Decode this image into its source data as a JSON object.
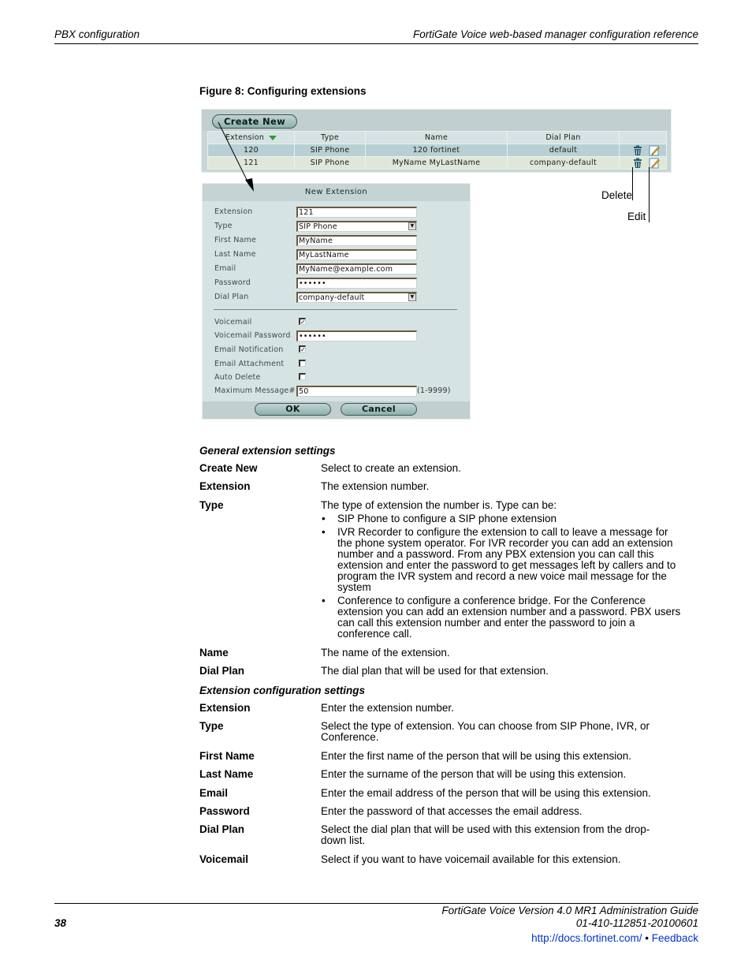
{
  "running_header": {
    "left": "PBX configuration",
    "right": "FortiGate Voice web-based manager configuration reference"
  },
  "figure": {
    "caption": "Figure 8: Configuring extensions",
    "extension_list": {
      "create_new_label": "Create New",
      "columns": [
        "Extension",
        "Type",
        "Name",
        "Dial Plan",
        ""
      ],
      "sort_column": "Extension",
      "rows": [
        {
          "extension": "120",
          "type": "SIP Phone",
          "name": "120 fortinet",
          "dial_plan": "default",
          "actions": [
            "delete-icon",
            "edit-icon"
          ]
        },
        {
          "extension": "121",
          "type": "SIP Phone",
          "name": "MyName MyLastName",
          "dial_plan": "company-default",
          "actions": [
            "delete-icon",
            "edit-icon"
          ]
        }
      ]
    },
    "callouts": {
      "delete": "Delete",
      "edit": "Edit"
    },
    "new_extension_dialog": {
      "title": "New Extension",
      "fields": {
        "extension": {
          "label": "Extension",
          "value": "121"
        },
        "type": {
          "label": "Type",
          "value": "SIP Phone"
        },
        "first_name": {
          "label": "First Name",
          "value": "MyName"
        },
        "last_name": {
          "label": "Last Name",
          "value": "MyLastName"
        },
        "email": {
          "label": "Email",
          "value": "MyName@example.com"
        },
        "password": {
          "label": "Password",
          "value": "••••••"
        },
        "dial_plan": {
          "label": "Dial Plan",
          "value": "company-default"
        },
        "voicemail": {
          "label": "Voicemail",
          "checked": true,
          "mark": "✓"
        },
        "voicemail_password": {
          "label": "Voicemail Password",
          "value": "••••••"
        },
        "email_notification": {
          "label": "Email Notification",
          "checked": true,
          "mark": "✓"
        },
        "email_attachment": {
          "label": "Email Attachment",
          "checked": false,
          "mark": ""
        },
        "auto_delete": {
          "label": "Auto Delete",
          "checked": false,
          "mark": ""
        },
        "maximum_message": {
          "label": "Maximum Message#",
          "value": "50",
          "hint": "(1-9999)"
        }
      },
      "ok_label": "OK",
      "cancel_label": "Cancel"
    }
  },
  "general_settings": {
    "heading": "General extension settings",
    "items": [
      {
        "term": "Create New",
        "definition": "Select to create an extension."
      },
      {
        "term": "Extension",
        "definition": "The extension number."
      },
      {
        "term": "Type",
        "definition": "The type of extension the number is. Type can be:",
        "bullets": [
          "SIP Phone to configure a SIP phone extension",
          "IVR Recorder to configure the extension to call to leave a message for the phone system operator. For IVR recorder you can add an extension number and a password. From any PBX extension you can call this extension and enter the password to get messages left by callers and to program the IVR system and record a new voice mail message for the system",
          "Conference to configure a conference bridge. For the Conference extension you can add an extension number and a password. PBX users can call this extension number and enter the password to join a conference call."
        ]
      },
      {
        "term": "Name",
        "definition": "The name of the extension."
      },
      {
        "term": "Dial Plan",
        "definition": "The dial plan that will be used for that extension."
      }
    ]
  },
  "config_settings": {
    "heading": "Extension configuration settings",
    "items": [
      {
        "term": "Extension",
        "definition": "Enter the extension number."
      },
      {
        "term": "Type",
        "definition": "Select the type of extension. You can choose from SIP Phone, IVR, or Conference."
      },
      {
        "term": "First Name",
        "definition": "Enter the first name of the person that will be using this extension."
      },
      {
        "term": "Last Name",
        "definition": "Enter the surname of the person that will be using this extension."
      },
      {
        "term": "Email",
        "definition": "Enter the email address of the person that will be using this extension."
      },
      {
        "term": "Password",
        "definition": "Enter the password of that accesses the email address."
      },
      {
        "term": "Dial Plan",
        "definition": "Select the dial plan that will be used with this extension from the drop-down list."
      },
      {
        "term": "Voicemail",
        "definition": "Select if you want to have voicemail available for this extension."
      }
    ]
  },
  "footer": {
    "page_number": "38",
    "guide_title": "FortiGate Voice Version 4.0 MR1 Administration Guide",
    "doc_number": "01-410-112851-20100601",
    "link_url_text": "http://docs.fortinet.com/",
    "separator": " • ",
    "feedback_label": "Feedback"
  }
}
